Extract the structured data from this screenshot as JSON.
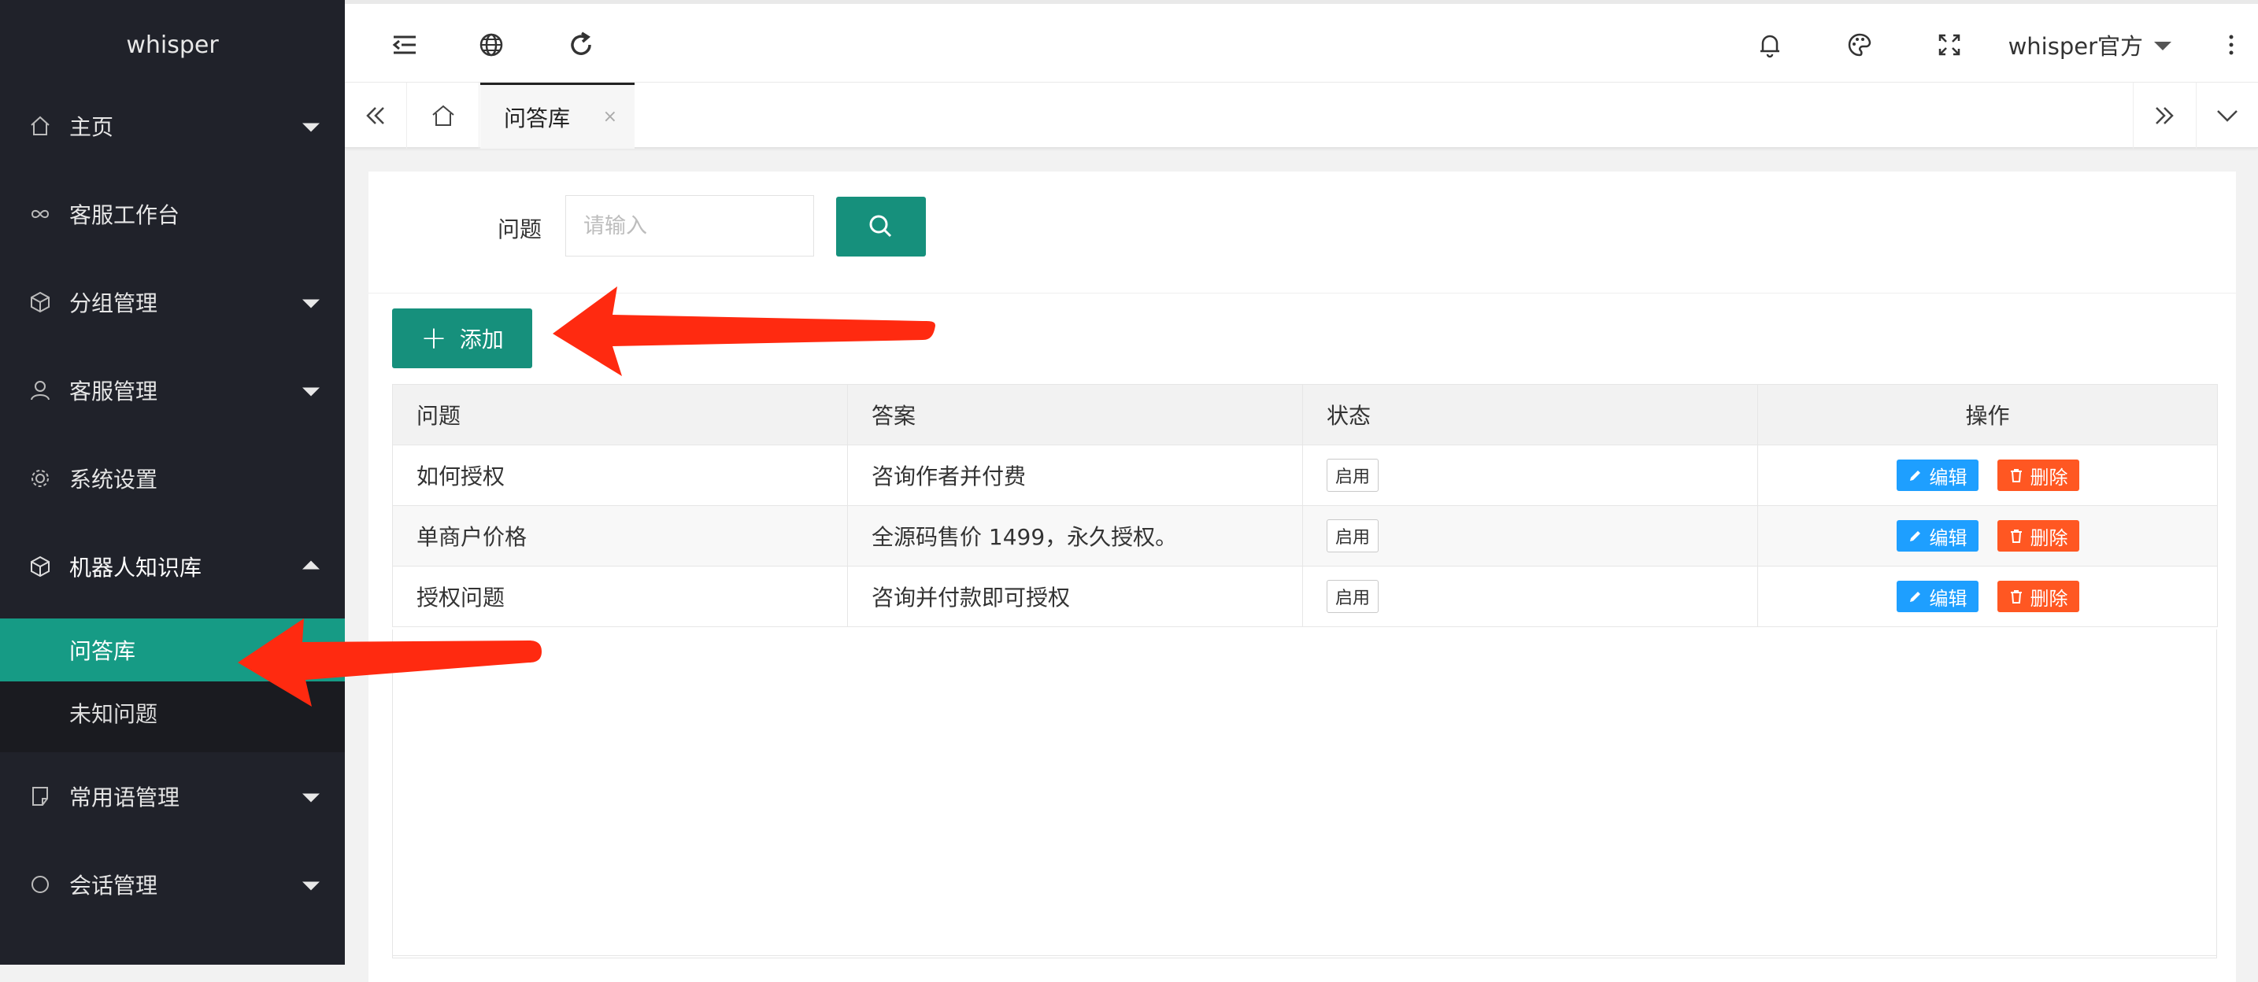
{
  "sidebar": {
    "logo": "whisper",
    "items": [
      {
        "label": "主页",
        "icon": "home-icon",
        "caret": "down"
      },
      {
        "label": "客服工作台",
        "icon": "infinity-icon",
        "caret": ""
      },
      {
        "label": "分组管理",
        "icon": "cube-icon",
        "caret": "down"
      },
      {
        "label": "客服管理",
        "icon": "user-icon",
        "caret": "down"
      },
      {
        "label": "系统设置",
        "icon": "gear-icon",
        "caret": ""
      },
      {
        "label": "机器人知识库",
        "icon": "cube-icon",
        "caret": "up"
      },
      {
        "label": "常用语管理",
        "icon": "note-icon",
        "caret": "down"
      },
      {
        "label": "会话管理",
        "icon": "circle-icon",
        "caret": "down"
      }
    ],
    "submenu": [
      {
        "label": "问答库",
        "active": true
      },
      {
        "label": "未知问题",
        "active": false
      }
    ]
  },
  "header": {
    "user_name": "whisper官方"
  },
  "tabs": {
    "active_label": "问答库",
    "close_glyph": "×"
  },
  "search": {
    "label": "问题",
    "placeholder": "请输入"
  },
  "toolbar": {
    "add_label": "添加"
  },
  "table": {
    "columns": [
      "问题",
      "答案",
      "状态",
      "操作"
    ],
    "rows": [
      {
        "question": "如何授权",
        "answer": "咨询作者并付费",
        "status": "启用"
      },
      {
        "question": "单商户价格",
        "answer": "全源码售价 1499，永久授权。",
        "status": "启用"
      },
      {
        "question": "授权问题",
        "answer": "咨询并付款即可授权",
        "status": "启用"
      }
    ],
    "edit_label": "编辑",
    "delete_label": "删除"
  },
  "colors": {
    "accent": "#16907c",
    "sidebar_bg": "#20222a",
    "active_menu": "#169b85",
    "edit_button": "#1e9fff",
    "delete_button": "#ff5722",
    "annotation_arrow": "#ff2a10"
  }
}
